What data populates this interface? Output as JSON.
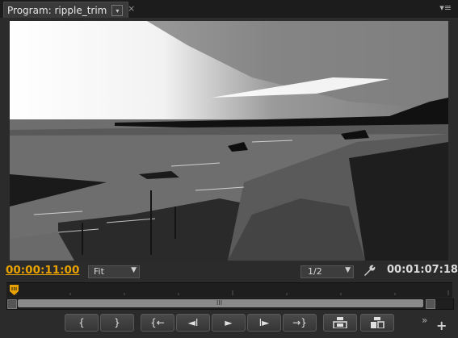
{
  "tab": {
    "title": "Program: ripple_trim",
    "menu_glyph": "▾",
    "close_glyph": "×"
  },
  "panel_menu_glyph": "▾≡",
  "viewer": {
    "description_color_sky": "#ffffff",
    "water_color": "#6d6d6d"
  },
  "timecodes": {
    "current": "00:00:11:00",
    "duration": "00:01:07:18",
    "current_color": "#e8a200"
  },
  "zoom": {
    "selected": "Fit",
    "arrow": "▼"
  },
  "resolution": {
    "selected": "1/2",
    "arrow": "▼"
  },
  "scrollbar": {
    "grip": "III"
  },
  "transport": [
    {
      "name": "mark-in-button",
      "glyph": "{"
    },
    {
      "name": "mark-out-button",
      "glyph": "}"
    },
    {
      "name": "go-to-in-button",
      "glyph": "{←"
    },
    {
      "name": "step-back-button",
      "glyph": "◄I"
    },
    {
      "name": "play-button",
      "glyph": "►"
    },
    {
      "name": "step-forward-button",
      "glyph": "I►"
    },
    {
      "name": "go-to-out-button",
      "glyph": "→}"
    }
  ],
  "extra": {
    "more": "»",
    "add": "+"
  }
}
